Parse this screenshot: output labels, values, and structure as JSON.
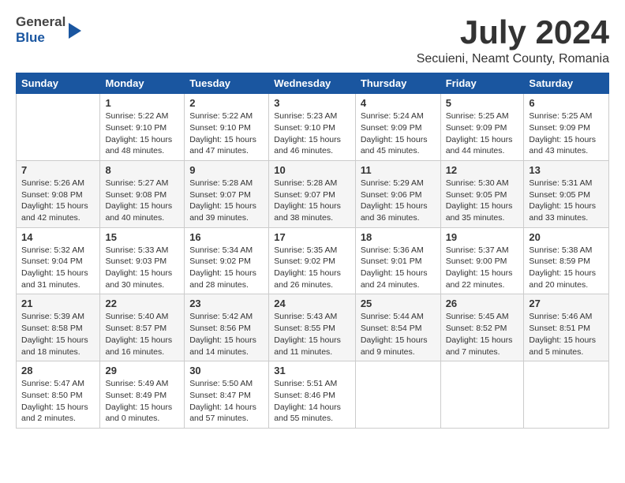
{
  "header": {
    "logo_general": "General",
    "logo_blue": "Blue",
    "month": "July 2024",
    "location": "Secuieni, Neamt County, Romania"
  },
  "days_of_week": [
    "Sunday",
    "Monday",
    "Tuesday",
    "Wednesday",
    "Thursday",
    "Friday",
    "Saturday"
  ],
  "weeks": [
    [
      {
        "day": "",
        "lines": []
      },
      {
        "day": "1",
        "lines": [
          "Sunrise: 5:22 AM",
          "Sunset: 9:10 PM",
          "Daylight: 15 hours",
          "and 48 minutes."
        ]
      },
      {
        "day": "2",
        "lines": [
          "Sunrise: 5:22 AM",
          "Sunset: 9:10 PM",
          "Daylight: 15 hours",
          "and 47 minutes."
        ]
      },
      {
        "day": "3",
        "lines": [
          "Sunrise: 5:23 AM",
          "Sunset: 9:10 PM",
          "Daylight: 15 hours",
          "and 46 minutes."
        ]
      },
      {
        "day": "4",
        "lines": [
          "Sunrise: 5:24 AM",
          "Sunset: 9:09 PM",
          "Daylight: 15 hours",
          "and 45 minutes."
        ]
      },
      {
        "day": "5",
        "lines": [
          "Sunrise: 5:25 AM",
          "Sunset: 9:09 PM",
          "Daylight: 15 hours",
          "and 44 minutes."
        ]
      },
      {
        "day": "6",
        "lines": [
          "Sunrise: 5:25 AM",
          "Sunset: 9:09 PM",
          "Daylight: 15 hours",
          "and 43 minutes."
        ]
      }
    ],
    [
      {
        "day": "7",
        "lines": [
          "Sunrise: 5:26 AM",
          "Sunset: 9:08 PM",
          "Daylight: 15 hours",
          "and 42 minutes."
        ]
      },
      {
        "day": "8",
        "lines": [
          "Sunrise: 5:27 AM",
          "Sunset: 9:08 PM",
          "Daylight: 15 hours",
          "and 40 minutes."
        ]
      },
      {
        "day": "9",
        "lines": [
          "Sunrise: 5:28 AM",
          "Sunset: 9:07 PM",
          "Daylight: 15 hours",
          "and 39 minutes."
        ]
      },
      {
        "day": "10",
        "lines": [
          "Sunrise: 5:28 AM",
          "Sunset: 9:07 PM",
          "Daylight: 15 hours",
          "and 38 minutes."
        ]
      },
      {
        "day": "11",
        "lines": [
          "Sunrise: 5:29 AM",
          "Sunset: 9:06 PM",
          "Daylight: 15 hours",
          "and 36 minutes."
        ]
      },
      {
        "day": "12",
        "lines": [
          "Sunrise: 5:30 AM",
          "Sunset: 9:05 PM",
          "Daylight: 15 hours",
          "and 35 minutes."
        ]
      },
      {
        "day": "13",
        "lines": [
          "Sunrise: 5:31 AM",
          "Sunset: 9:05 PM",
          "Daylight: 15 hours",
          "and 33 minutes."
        ]
      }
    ],
    [
      {
        "day": "14",
        "lines": [
          "Sunrise: 5:32 AM",
          "Sunset: 9:04 PM",
          "Daylight: 15 hours",
          "and 31 minutes."
        ]
      },
      {
        "day": "15",
        "lines": [
          "Sunrise: 5:33 AM",
          "Sunset: 9:03 PM",
          "Daylight: 15 hours",
          "and 30 minutes."
        ]
      },
      {
        "day": "16",
        "lines": [
          "Sunrise: 5:34 AM",
          "Sunset: 9:02 PM",
          "Daylight: 15 hours",
          "and 28 minutes."
        ]
      },
      {
        "day": "17",
        "lines": [
          "Sunrise: 5:35 AM",
          "Sunset: 9:02 PM",
          "Daylight: 15 hours",
          "and 26 minutes."
        ]
      },
      {
        "day": "18",
        "lines": [
          "Sunrise: 5:36 AM",
          "Sunset: 9:01 PM",
          "Daylight: 15 hours",
          "and 24 minutes."
        ]
      },
      {
        "day": "19",
        "lines": [
          "Sunrise: 5:37 AM",
          "Sunset: 9:00 PM",
          "Daylight: 15 hours",
          "and 22 minutes."
        ]
      },
      {
        "day": "20",
        "lines": [
          "Sunrise: 5:38 AM",
          "Sunset: 8:59 PM",
          "Daylight: 15 hours",
          "and 20 minutes."
        ]
      }
    ],
    [
      {
        "day": "21",
        "lines": [
          "Sunrise: 5:39 AM",
          "Sunset: 8:58 PM",
          "Daylight: 15 hours",
          "and 18 minutes."
        ]
      },
      {
        "day": "22",
        "lines": [
          "Sunrise: 5:40 AM",
          "Sunset: 8:57 PM",
          "Daylight: 15 hours",
          "and 16 minutes."
        ]
      },
      {
        "day": "23",
        "lines": [
          "Sunrise: 5:42 AM",
          "Sunset: 8:56 PM",
          "Daylight: 15 hours",
          "and 14 minutes."
        ]
      },
      {
        "day": "24",
        "lines": [
          "Sunrise: 5:43 AM",
          "Sunset: 8:55 PM",
          "Daylight: 15 hours",
          "and 11 minutes."
        ]
      },
      {
        "day": "25",
        "lines": [
          "Sunrise: 5:44 AM",
          "Sunset: 8:54 PM",
          "Daylight: 15 hours",
          "and 9 minutes."
        ]
      },
      {
        "day": "26",
        "lines": [
          "Sunrise: 5:45 AM",
          "Sunset: 8:52 PM",
          "Daylight: 15 hours",
          "and 7 minutes."
        ]
      },
      {
        "day": "27",
        "lines": [
          "Sunrise: 5:46 AM",
          "Sunset: 8:51 PM",
          "Daylight: 15 hours",
          "and 5 minutes."
        ]
      }
    ],
    [
      {
        "day": "28",
        "lines": [
          "Sunrise: 5:47 AM",
          "Sunset: 8:50 PM",
          "Daylight: 15 hours",
          "and 2 minutes."
        ]
      },
      {
        "day": "29",
        "lines": [
          "Sunrise: 5:49 AM",
          "Sunset: 8:49 PM",
          "Daylight: 15 hours",
          "and 0 minutes."
        ]
      },
      {
        "day": "30",
        "lines": [
          "Sunrise: 5:50 AM",
          "Sunset: 8:47 PM",
          "Daylight: 14 hours",
          "and 57 minutes."
        ]
      },
      {
        "day": "31",
        "lines": [
          "Sunrise: 5:51 AM",
          "Sunset: 8:46 PM",
          "Daylight: 14 hours",
          "and 55 minutes."
        ]
      },
      {
        "day": "",
        "lines": []
      },
      {
        "day": "",
        "lines": []
      },
      {
        "day": "",
        "lines": []
      }
    ]
  ]
}
